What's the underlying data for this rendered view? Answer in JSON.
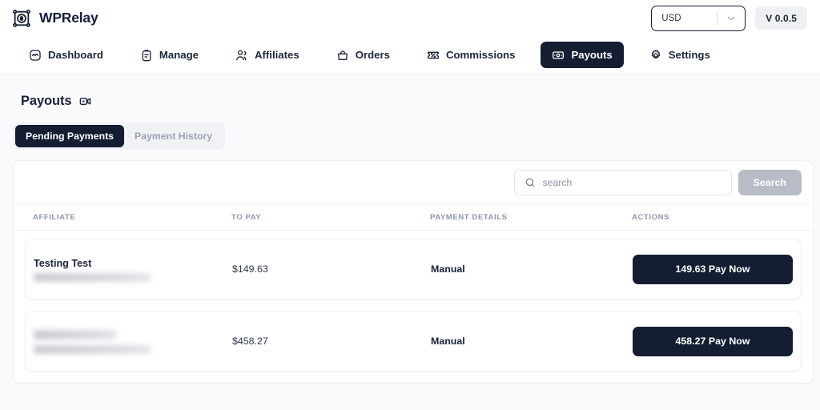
{
  "app": {
    "brand_name": "WPRelay",
    "brand_icon": "network-dollar-icon",
    "version_label": "V 0.0.5"
  },
  "currency_select": {
    "value": "USD",
    "icon": "chevron-down-icon"
  },
  "nav": {
    "items": [
      {
        "label": "Dashboard",
        "icon": "activity-square-icon",
        "active": false
      },
      {
        "label": "Manage",
        "icon": "clipboard-icon",
        "active": false
      },
      {
        "label": "Affiliates",
        "icon": "users-icon",
        "active": false
      },
      {
        "label": "Orders",
        "icon": "bag-icon",
        "active": false
      },
      {
        "label": "Commissions",
        "icon": "ticket-percent-icon",
        "active": false
      },
      {
        "label": "Payouts",
        "icon": "banknote-icon",
        "active": true
      },
      {
        "label": "Settings",
        "icon": "gear-icon",
        "active": false
      }
    ]
  },
  "page": {
    "title": "Payouts",
    "title_icon": "video-camera-icon"
  },
  "tabs": [
    {
      "label": "Pending Payments",
      "active": true
    },
    {
      "label": "Payment History",
      "active": false
    }
  ],
  "search": {
    "placeholder": "search",
    "value": "",
    "icon": "search-icon",
    "button_label": "Search"
  },
  "table": {
    "columns": [
      "AFFILIATE",
      "TO PAY",
      "PAYMENT DETAILS",
      "ACTIONS"
    ],
    "rows": [
      {
        "affiliate_name": "Testing Test",
        "affiliate_name_redacted": false,
        "affiliate_email": "",
        "affiliate_email_redacted": true,
        "to_pay": "$149.63",
        "payment_details": "Manual",
        "action_label": "149.63 Pay Now"
      },
      {
        "affiliate_name": "",
        "affiliate_name_redacted": true,
        "affiliate_email": "",
        "affiliate_email_redacted": true,
        "to_pay": "$458.27",
        "payment_details": "Manual",
        "action_label": "458.27 Pay Now"
      }
    ]
  },
  "colors": {
    "brand_dark": "#141d31",
    "page_bg": "#fafafc",
    "panel_bg": "#ffffff",
    "muted_text": "#8d97ae",
    "search_button": "#b8bcc6"
  }
}
